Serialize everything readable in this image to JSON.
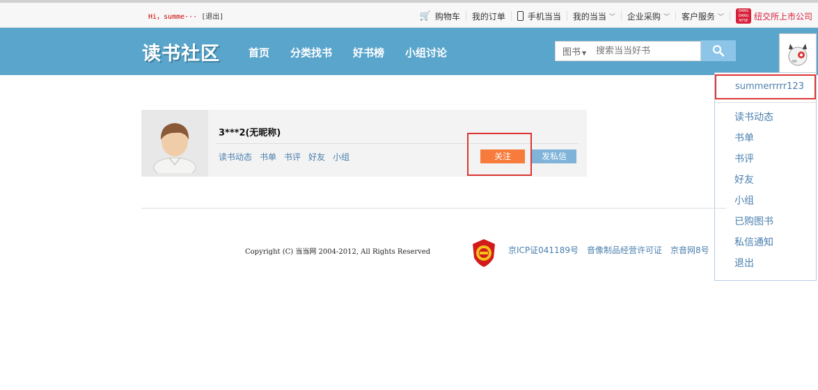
{
  "topbar": {
    "greeting": "Hi，summe···",
    "logout": "[退出]",
    "cart": "购物车",
    "orders": "我的订单",
    "mobile": "手机当当",
    "my_dangdang": "我的当当",
    "enterprise": "企业采购",
    "service": "客户服务",
    "nyse": "纽交所上市公司",
    "nyse_logo": "DANG DANG NYSE"
  },
  "header": {
    "logo": "读书社区",
    "nav": [
      "首页",
      "分类找书",
      "好书榜",
      "小组讨论"
    ],
    "search_category": "图书",
    "search_placeholder": "搜索当当好书"
  },
  "dropdown": {
    "username": "summerrrrr123",
    "items": [
      "读书动态",
      "书单",
      "书评",
      "好友",
      "小组",
      "已购图书",
      "私信通知",
      "退出"
    ]
  },
  "profile": {
    "name": "3***2(无昵称)",
    "links": [
      "读书动态",
      "书单",
      "书评",
      "好友",
      "小组"
    ],
    "follow": "关注",
    "message": "发私信"
  },
  "footer": {
    "copyright": "Copyright (C) 当当网 2004-2012, All Rights Reserved",
    "links": [
      "京ICP证041189号",
      "音像制品经营许可证",
      "京音网8号"
    ]
  },
  "colors": {
    "header": "#5aa5cb",
    "follow": "#f77c3c",
    "link": "#4a7fae",
    "highlight": "#dd3333"
  }
}
